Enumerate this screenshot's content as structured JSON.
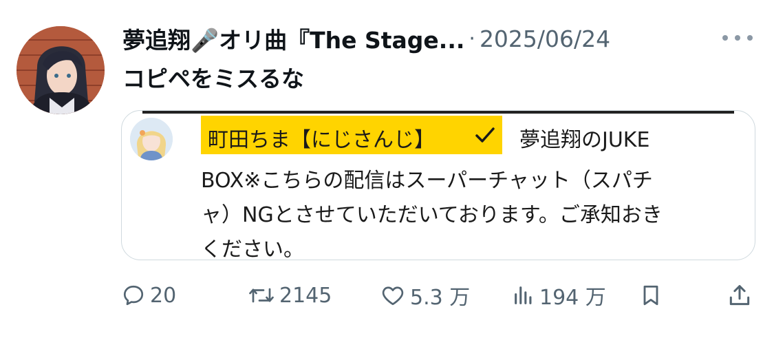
{
  "tweet": {
    "author": "夢追翔🎤オリ曲『The Stage...",
    "separator": "·",
    "date": "2025/06/24",
    "text": "コピペをミスるな"
  },
  "quote": {
    "name": "町田ちま【にじさんじ】",
    "name_suffix": "夢追翔のJUKE",
    "line2": "BOX※こちらの配信はスーパーチャット（スパチ",
    "line3": "ャ）NGとさせていただいております。ご承知おき",
    "line4": "ください。",
    "highlight_color": "#ffd400"
  },
  "actions": {
    "replies": "20",
    "retweets": "2145",
    "likes": "5.3 万",
    "views": "194 万"
  },
  "icons": {
    "reply": "reply-icon",
    "retweet": "retweet-icon",
    "like": "heart-icon",
    "views": "views-icon",
    "bookmark": "bookmark-icon",
    "share": "share-icon",
    "more": "more-icon"
  },
  "colors": {
    "text": "#0f1419",
    "secondary": "#536471",
    "border": "#cfd9de"
  }
}
